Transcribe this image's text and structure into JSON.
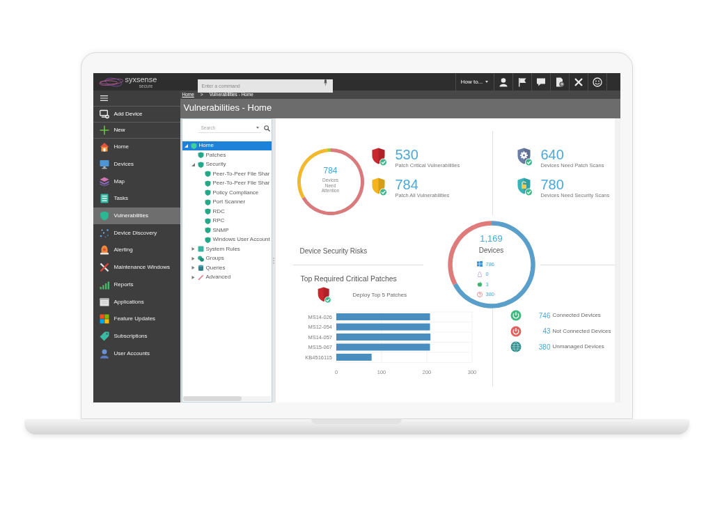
{
  "top_bar": {
    "logo": {
      "name": "syxsense",
      "tagline": "secure"
    },
    "command_field": {
      "placeholder": "Enter a command"
    },
    "how_to": {
      "label": "How to..."
    }
  },
  "sidebar": {
    "actions": [
      {
        "label": "Add Device"
      },
      {
        "label": "New"
      }
    ],
    "items": [
      {
        "label": "Home",
        "selected": false
      },
      {
        "label": "Devices",
        "selected": false
      },
      {
        "label": "Map",
        "selected": false
      },
      {
        "label": "Tasks",
        "selected": false
      },
      {
        "label": "Vulnerabilities",
        "selected": true
      },
      {
        "label": "Device Discovery",
        "selected": false
      },
      {
        "label": "Alerting",
        "selected": false
      },
      {
        "label": "Maintenance Windows",
        "selected": false
      },
      {
        "label": "Reports",
        "selected": false
      },
      {
        "label": "Applications",
        "selected": false
      },
      {
        "label": "Feature Updates",
        "selected": false
      },
      {
        "label": "Subscriptions",
        "selected": false
      },
      {
        "label": "User Accounts",
        "selected": false
      }
    ]
  },
  "header": {
    "breadcrumb": [
      {
        "label": "Home",
        "kind": "link"
      },
      {
        "label": ">",
        "kind": "separator"
      },
      {
        "label": "Vulnerabilities - Home",
        "kind": "current"
      }
    ],
    "title": "Vulnerabilities - Home"
  },
  "tree": {
    "search": {
      "placeholder": "Search"
    },
    "nodes": [
      {
        "label": "Home",
        "selected": true,
        "expanded": true,
        "children": [
          {
            "label": "Patches",
            "selected": false
          },
          {
            "label": "Security",
            "selected": false,
            "expanded": true,
            "children": [
              {
                "label": "Peer-To-Peer File Shar",
                "selected": false
              },
              {
                "label": "Peer-To-Peer File Shar",
                "selected": false
              },
              {
                "label": "Policy Compliance",
                "selected": false
              },
              {
                "label": "Port Scanner",
                "selected": false
              },
              {
                "label": "RDC",
                "selected": false
              },
              {
                "label": "RPC",
                "selected": false
              },
              {
                "label": "SNMP",
                "selected": false
              },
              {
                "label": "Windows User Account",
                "selected": false
              }
            ]
          },
          {
            "label": "System Rules",
            "selected": false,
            "expanded": false
          },
          {
            "label": "Groups",
            "selected": false,
            "expanded": false
          },
          {
            "label": "Queries",
            "selected": false,
            "expanded": false
          },
          {
            "label": "Advanced",
            "selected": false,
            "expanded": false
          }
        ]
      }
    ]
  },
  "dashboard": {
    "attention": {
      "value": "784",
      "label": "Devices Need Attention"
    },
    "patch_stats": [
      {
        "value": "530",
        "label": "Patch Critical Vulnerabilities"
      },
      {
        "value": "784",
        "label": "Patch All Vulnerabilities"
      }
    ],
    "scan_stats": [
      {
        "value": "640",
        "label": "Devices Need Patch Scans"
      },
      {
        "value": "780",
        "label": "Devices Need Security Scans"
      }
    ],
    "security_risks": {
      "title": "Device Security Risks"
    },
    "devices": {
      "total": "1,169",
      "label": "Devices",
      "os_counts": [
        {
          "count": "786"
        },
        {
          "count": "0"
        },
        {
          "count": "3"
        },
        {
          "count": "380"
        }
      ]
    },
    "critical_patches": {
      "title": "Top Required Critical Patches",
      "action": "Deploy Top 5 Patches",
      "chart_data": {
        "type": "bar",
        "orientation": "horizontal",
        "categories": [
          "MS14-026",
          "MS12-054",
          "MS14-057",
          "MS15-067",
          "KB4516115"
        ],
        "values": [
          207,
          207,
          208,
          207,
          78
        ],
        "xlim": [
          0,
          300
        ],
        "xticks": [
          0,
          100,
          200,
          300
        ]
      }
    },
    "connections": [
      {
        "count": "746",
        "label": "Connected Devices",
        "color": "#3dbb7e"
      },
      {
        "count": "43",
        "label": "Not Connected Devices",
        "color": "#e0615f"
      },
      {
        "count": "380",
        "label": "Unmanaged Devices",
        "color": "#2c8b8b"
      }
    ]
  }
}
